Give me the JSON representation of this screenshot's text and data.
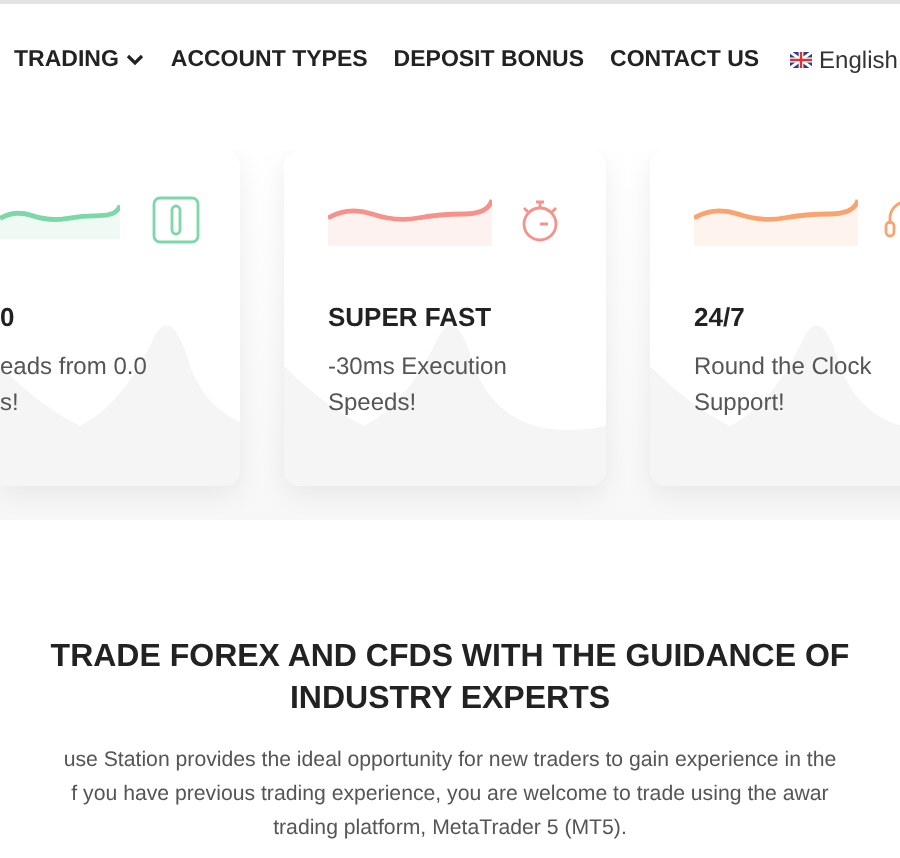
{
  "nav": {
    "items": [
      {
        "label": "TRADING",
        "kind": "dropdown"
      },
      {
        "label": "ACCOUNT TYPES",
        "kind": "link"
      },
      {
        "label": "DEPOSIT BONUS",
        "kind": "link"
      },
      {
        "label": "CONTACT US",
        "kind": "link"
      }
    ],
    "language": {
      "label": "English"
    }
  },
  "features": [
    {
      "kind": "clip",
      "color": "#7dd8a8",
      "title": "0",
      "lines": [
        "eads from 0.0",
        "s!"
      ]
    },
    {
      "kind": "stopwatch",
      "color": "#f7928a",
      "title": "SUPER FAST",
      "lines": [
        "-30ms Execution",
        "Speeds!"
      ]
    },
    {
      "kind": "headset",
      "color": "#f9a36d",
      "title": "24/7",
      "lines": [
        "Round the Clock",
        "Support!"
      ]
    }
  ],
  "section": {
    "title": "TRADE FOREX AND CFDS WITH THE GUIDANCE OF INDUSTRY EXPERTS",
    "lines": [
      "use Station provides the ideal opportunity for new traders to gain experience in the",
      "f you have previous trading experience, you are welcome to trade using the awar",
      "trading platform, MetaTrader 5 (MT5)."
    ]
  }
}
